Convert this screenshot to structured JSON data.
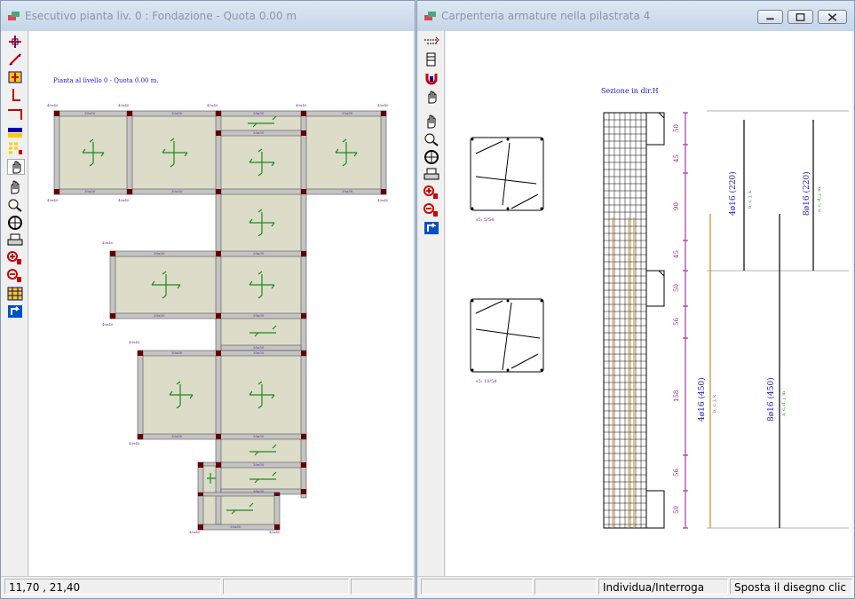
{
  "left_window": {
    "title": "Esecutivo pianta liv. 0 : Fondazione - Quota 0.00 m",
    "plan_caption": "Pianta al livello 0 - Quota 0.00 m.",
    "toolbar_icons": [
      "pick-node-icon",
      "measure-icon",
      "section-icon",
      "column-icon",
      "beam-icon",
      "slab-icon",
      "grid-icon",
      "hand-icon",
      "pan-icon",
      "zoom-icon",
      "compass-icon",
      "print-icon",
      "zoom-in-icon",
      "zoom-out-icon",
      "table-icon",
      "redraw-icon"
    ],
    "status": {
      "coords": "11,70 , 21,40",
      "field2": "",
      "field3": ""
    }
  },
  "right_window": {
    "title": "Carpenteria armature nella pilastrata  4",
    "section_title": "Sezione in dir.H",
    "toolbar_icons": [
      "align-icon",
      "stack-icon",
      "magnet-icon",
      "hand-icon",
      "pan-icon",
      "zoom-icon",
      "compass-icon",
      "print-icon",
      "zoom-in-icon",
      "zoom-out-icon",
      "redraw-icon"
    ],
    "section_labels": {
      "top": "s5: 5/54",
      "bottom": "s5: 10/54"
    },
    "dimensions": [
      "50",
      "45",
      "90",
      "45",
      "50",
      "56",
      "158",
      "56",
      "50"
    ],
    "bars": [
      {
        "label": "4ø16 (220)",
        "sub": "b, c, j, k"
      },
      {
        "label": "8ø16 (220)",
        "sub": "a, c, d, j, m"
      },
      {
        "label": "4ø16 (450)",
        "sub": "b, c, j, k"
      },
      {
        "label": "8ø16 (450)",
        "sub": "a, c, d, j, m"
      }
    ],
    "status": {
      "field1": "",
      "field2": "",
      "mode": "Individua/Interroga",
      "hint": "Sposta il disegno clic"
    }
  },
  "colors": {
    "beam": "#c0c0c0",
    "slab": "#dcdcc8",
    "rebar_green": "#1a8c1a",
    "dim_purple": "#8b1a8b",
    "label_blue": "#1a1acc",
    "bar_orange": "#c88a2a"
  }
}
